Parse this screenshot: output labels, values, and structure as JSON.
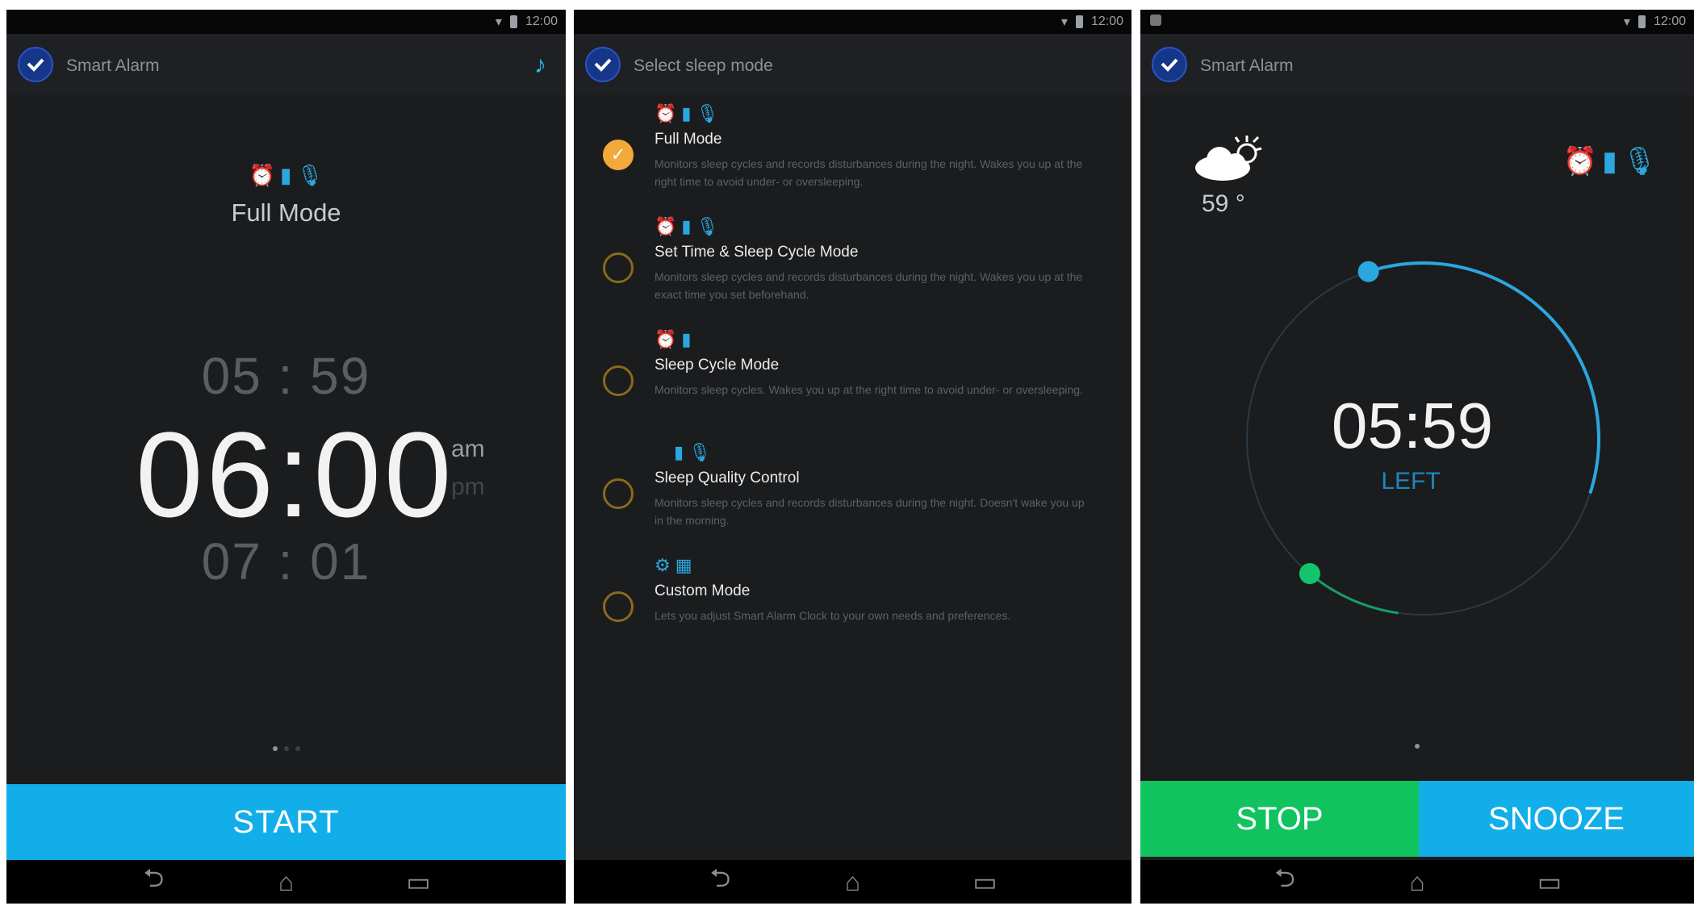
{
  "colors": {
    "accent_blue": "#11aee9",
    "stop_green": "#10c35f",
    "radio_orange": "#f2a93b",
    "background": "#1b1c1e"
  },
  "status_bar": {
    "time": "12:00"
  },
  "screen1": {
    "title": "Smart Alarm",
    "mode_icons": [
      "alarm-clock-icon",
      "bar-chart-icon",
      "microphone-icon"
    ],
    "mode_name": "Full Mode",
    "time_prev": "05 : 59",
    "time_main": "06:00",
    "am": "am",
    "pm": "pm",
    "time_next": "07 : 01",
    "start_label": "START"
  },
  "screen2": {
    "title": "Select sleep mode",
    "modes": [
      {
        "title": "Full Mode",
        "description": "Monitors sleep cycles and records disturbances during the night. Wakes you up at the right time to avoid under- or oversleeping.",
        "selected": true,
        "icons": [
          "alarm-clock-icon",
          "bar-chart-icon",
          "microphone-icon"
        ]
      },
      {
        "title": "Set Time & Sleep Cycle Mode",
        "description": "Monitors sleep cycles and records disturbances during the night. Wakes you up at the exact time you set beforehand.",
        "selected": false,
        "icons": [
          "alarm-clock-icon",
          "bar-chart-icon",
          "microphone-icon"
        ]
      },
      {
        "title": "Sleep Cycle Mode",
        "description": "Monitors sleep cycles. Wakes you up at the right time to avoid under- or oversleeping.",
        "selected": false,
        "icons": [
          "alarm-clock-icon",
          "bar-chart-icon"
        ]
      },
      {
        "title": "Sleep Quality Control",
        "description": "Monitors sleep cycles and records disturbances during the night. Doesn't wake you up in the morning.",
        "selected": false,
        "icons": [
          "bar-chart-icon",
          "microphone-icon"
        ]
      },
      {
        "title": "Custom Mode",
        "description": "Lets you adjust Smart Alarm Clock to your own needs and preferences.",
        "selected": false,
        "icons": [
          "gear-icon",
          "calendar-icon"
        ]
      }
    ]
  },
  "screen3": {
    "title": "Smart Alarm",
    "temperature": "59 °",
    "weather_icon": "partly-sunny-icon",
    "countdown": "05:59",
    "left_label": "LEFT",
    "stop_label": "STOP",
    "snooze_label": "SNOOZE",
    "progress_fraction": 0.35
  }
}
